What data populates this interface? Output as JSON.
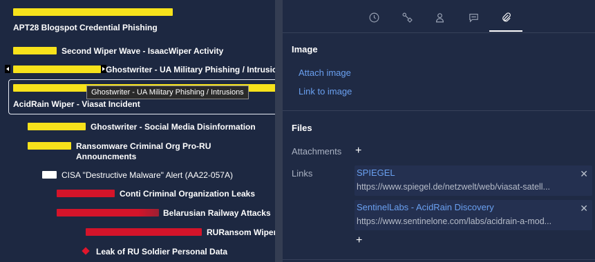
{
  "timeline": {
    "events": [
      {
        "label": "APT28 Blogspot Credential Phishing"
      },
      {
        "label": "Second Wiper Wave - IsaacWiper Activity"
      },
      {
        "label": "Ghostwriter - UA Military Phishing / Intrusions"
      },
      {
        "label": "AcidRain Wiper - Viasat Incident"
      },
      {
        "label": "Ghostwriter - Social Media Disinformation"
      },
      {
        "label_line1": "Ransomware Criminal Org Pro-RU",
        "label_line2": "Announcments"
      },
      {
        "label": "CISA \"Destructive Malware\" Alert (AA22-057A)"
      },
      {
        "label": "Conti Criminal Organization Leaks"
      },
      {
        "label": "Belarusian Railway Attacks"
      },
      {
        "label": "RURansom Wiper"
      },
      {
        "label": "Leak of RU Soldier Personal Data"
      }
    ],
    "tooltip": "Ghostwriter - UA  Military Phishing / Intrusions",
    "colors": {
      "yellow": "#f7e21b",
      "red": "#d4142a",
      "white": "#ffffff"
    }
  },
  "panel": {
    "tabs": [
      {
        "icon": "clock-icon"
      },
      {
        "icon": "relations-icon"
      },
      {
        "icon": "person-icon"
      },
      {
        "icon": "comment-icon"
      },
      {
        "icon": "paperclip-icon",
        "active": true
      }
    ],
    "image_section": {
      "title": "Image",
      "attach": "Attach image",
      "link": "Link to image"
    },
    "files_section": {
      "title": "Files",
      "attachments_label": "Attachments",
      "add_symbol": "+",
      "links_label": "Links",
      "links": [
        {
          "title": "SPIEGEL",
          "url": "https://www.spiegel.de/netzwelt/web/viasat-satell...",
          "close": "✕"
        },
        {
          "title": "SentinelLabs - AcidRain Discovery",
          "url": "https://www.sentinelone.com/labs/acidrain-a-mod...",
          "close": "✕"
        }
      ],
      "add_link_symbol": "+"
    }
  }
}
